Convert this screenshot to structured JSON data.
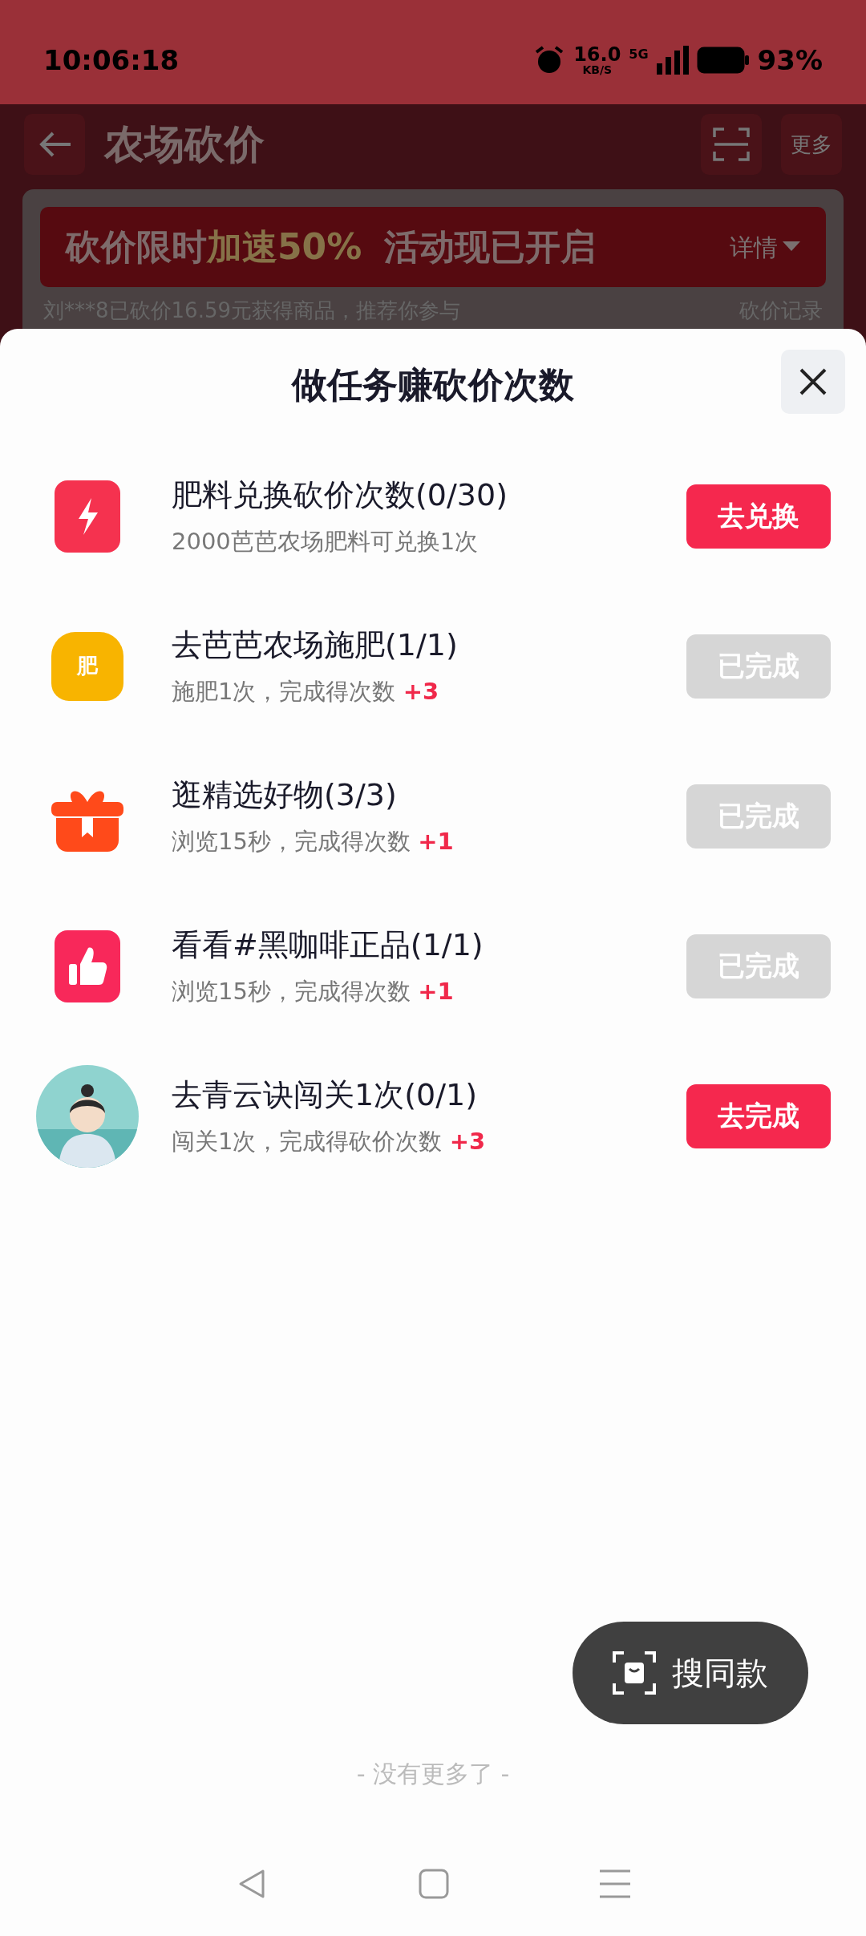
{
  "status_bar": {
    "time": "10:06:18",
    "speed": "16.0",
    "speed_unit": "KB/S",
    "network": "5G",
    "battery": "93%"
  },
  "header": {
    "title": "农场砍价",
    "more": "更多"
  },
  "banner": {
    "text_a": "砍价限时",
    "text_b": "加速50%",
    "text_c": "活动现已开启",
    "details": "详情",
    "notice": "刘***8已砍价16.59元获得商品，推荐你参与",
    "record": "砍价记录"
  },
  "sheet": {
    "title": "做任务赚砍价次数",
    "tasks": [
      {
        "kind": "bolt",
        "title": "肥料兑换砍价次数(0/30)",
        "subtitle": "2000芭芭农场肥料可兑换1次",
        "button": "去兑换",
        "done": false
      },
      {
        "kind": "bag",
        "icon_text": "肥",
        "title": "去芭芭农场施肥(1/1)",
        "subtitle": "施肥1次，完成得次数 **+3**",
        "button": "已完成",
        "done": true
      },
      {
        "kind": "gift",
        "title": "逛精选好物(3/3)",
        "subtitle": "浏览15秒，完成得次数 **+1**",
        "button": "已完成",
        "done": true
      },
      {
        "kind": "thumb",
        "title": "看看#黑咖啡正品(1/1)",
        "subtitle": "浏览15秒，完成得次数 **+1**",
        "button": "已完成",
        "done": true
      },
      {
        "kind": "avatar",
        "title": "去青云诀闯关1次(0/1)",
        "subtitle": "闯关1次，完成得砍价次数 **+3**",
        "button": "去完成",
        "done": false
      }
    ],
    "end_text": "- 没有更多了 -"
  },
  "float_button": {
    "label": "搜同款"
  }
}
